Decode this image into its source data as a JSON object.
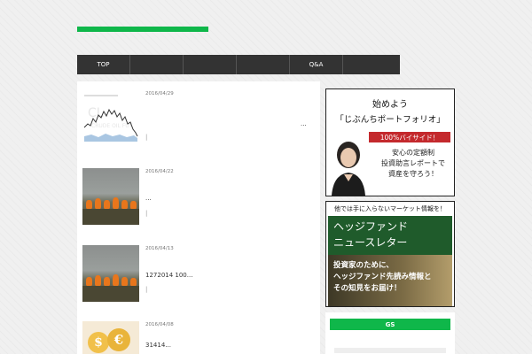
{
  "nav": {
    "items": [
      {
        "label": "TOP"
      },
      {
        "label": ""
      },
      {
        "label": ""
      },
      {
        "label": ""
      },
      {
        "label": "Q&A"
      },
      {
        "label": ""
      }
    ]
  },
  "posts": [
    {
      "date": "2016/04/29",
      "title": "...",
      "more": "|",
      "thumb": "crude-oil-chart"
    },
    {
      "date": "2016/04/22",
      "title": "...",
      "more": "|",
      "thumb": "oil-fire"
    },
    {
      "date": "2016/04/13",
      "title": "1272014 100...",
      "more": "|",
      "thumb": "oil-fire"
    },
    {
      "date": "2016/04/08",
      "title": "31414...",
      "more": "",
      "thumb": "currency-coins"
    }
  ],
  "thumb_text": {
    "chart_watermark": "CL",
    "chart_caption": "CRUDE OIL FUT",
    "coin_dollar": "$",
    "coin_euro": "€"
  },
  "sidebar": {
    "ad1": {
      "title1": "始めよう",
      "title2": "「じぶんちポートフォリオ」",
      "badge": "100%バイサイド！",
      "copy_lines": [
        "安心の定額制",
        "投資助言レポートで",
        "資産を守ろう！"
      ]
    },
    "ad2": {
      "top": "他では手に入らないマーケット情報を！",
      "band_lines": [
        "ヘッジファンド",
        "ニュースレター"
      ],
      "lower_lines": [
        "投資家のために、",
        "ヘッジファンド先読み情報と",
        "その知見をお届け！"
      ]
    },
    "widget": {
      "title": "GS"
    }
  },
  "colors": {
    "accent": "#0fb74a",
    "nav_bg": "#333333",
    "badge_red": "#c4292d",
    "ad_green": "#1f5b2b"
  }
}
